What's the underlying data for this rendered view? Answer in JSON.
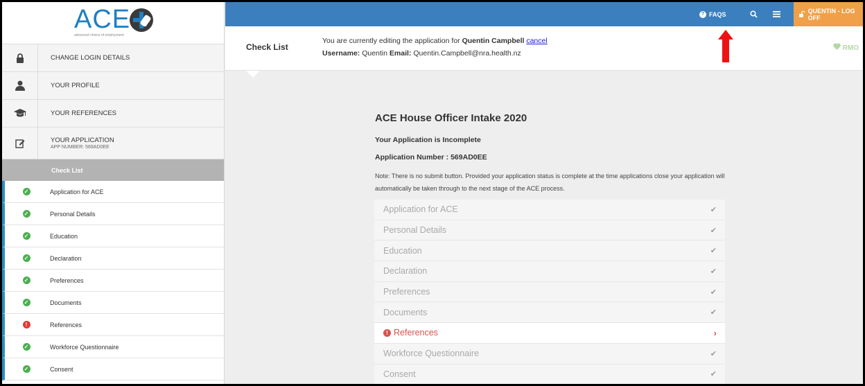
{
  "logo": {
    "text": "ACE",
    "tagline": "advanced choice of employment"
  },
  "sidebar": {
    "menu": [
      {
        "label": "CHANGE LOGIN DETAILS",
        "icon": "lock-icon"
      },
      {
        "label": "YOUR PROFILE",
        "icon": "user-icon"
      },
      {
        "label": "YOUR REFERENCES",
        "icon": "graduation-cap-icon"
      },
      {
        "label": "YOUR APPLICATION",
        "sublabel": "APP NUMBER: 569AD0EE",
        "icon": "edit-icon"
      }
    ],
    "checklist_header": "Check List",
    "steps": [
      {
        "label": "Application for ACE",
        "status": "complete"
      },
      {
        "label": "Personal Details",
        "status": "complete"
      },
      {
        "label": "Education",
        "status": "complete"
      },
      {
        "label": "Declaration",
        "status": "complete"
      },
      {
        "label": "Preferences",
        "status": "complete"
      },
      {
        "label": "Documents",
        "status": "complete"
      },
      {
        "label": "References",
        "status": "incomplete"
      },
      {
        "label": "Workforce Questionnaire",
        "status": "complete"
      },
      {
        "label": "Consent",
        "status": "complete"
      }
    ]
  },
  "topbar": {
    "faqs": "FAQS",
    "logoff": "QUENTIN - LOG OFF"
  },
  "header": {
    "title": "Check List",
    "editing_prefix": "You are currently editing the application for",
    "editing_name": "Quentin Campbell",
    "cancel": "cancel",
    "username_label": "Username:",
    "username": "Quentin",
    "email_label": "Email:",
    "email": "Quentin.Campbell@nra.health.nz",
    "rmo": "RMO"
  },
  "main": {
    "title": "ACE House Officer Intake 2020",
    "status": "Your Application is Incomplete",
    "app_number": "Application Number : 569AD0EE",
    "note": "Note: There is no submit button. Provided your application status is complete at the time applications close your application will automatically be taken through to the next stage of the ACE process.",
    "checklist": [
      {
        "label": "Application for ACE",
        "status": "complete"
      },
      {
        "label": "Personal Details",
        "status": "complete"
      },
      {
        "label": "Education",
        "status": "complete"
      },
      {
        "label": "Declaration",
        "status": "complete"
      },
      {
        "label": "Preferences",
        "status": "complete"
      },
      {
        "label": "Documents",
        "status": "complete"
      },
      {
        "label": "References",
        "status": "incomplete"
      },
      {
        "label": "Workforce Questionnaire",
        "status": "complete"
      },
      {
        "label": "Consent",
        "status": "complete"
      }
    ]
  },
  "colors": {
    "topbar": "#3b7fbe",
    "logoff": "#f0a048",
    "ok": "#4caf50",
    "error": "#d9534f",
    "annotation_arrow": "#ee1111"
  }
}
